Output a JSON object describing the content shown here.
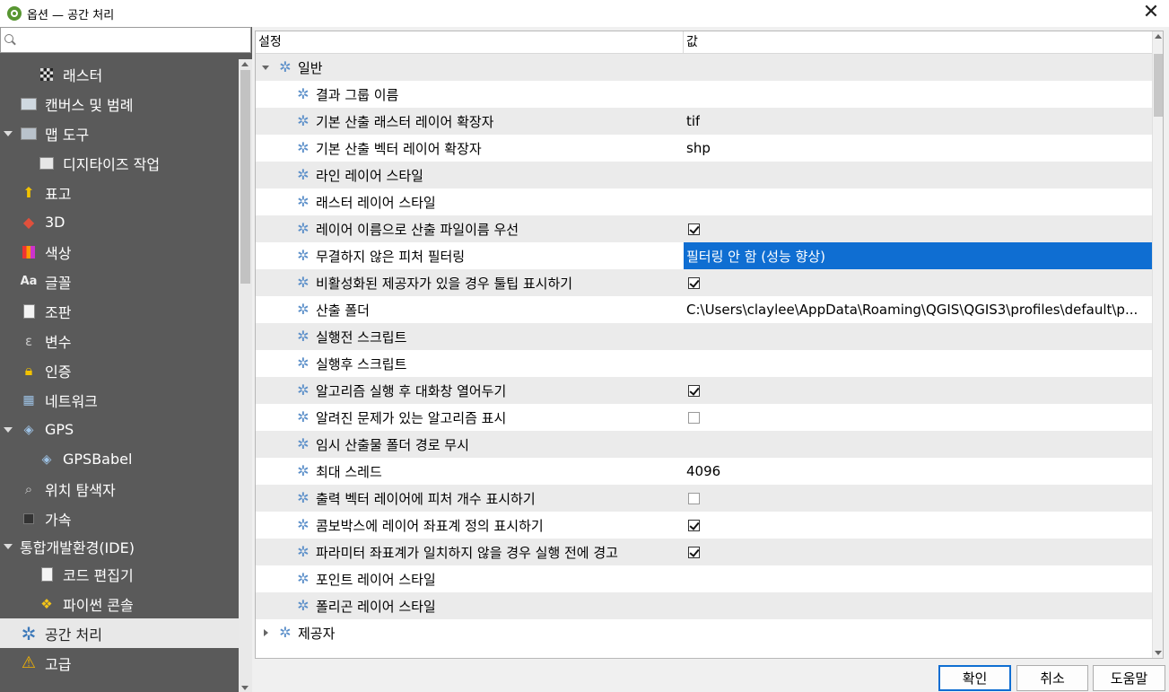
{
  "window": {
    "title": "옵션 — 공간 처리",
    "close_glyph": "✕"
  },
  "sidebar": {
    "search_placeholder": "",
    "items": [
      {
        "label": "래스터",
        "icon": "raster-checker-icon",
        "indent": 1,
        "expanded": null
      },
      {
        "label": "캔버스 및 범례",
        "icon": "canvas-legend-icon",
        "indent": 0,
        "expanded": null
      },
      {
        "label": "맵 도구",
        "icon": "map-tools-icon",
        "indent": 0,
        "expanded": true
      },
      {
        "label": "디지타이즈 작업",
        "icon": "digitize-icon",
        "indent": 1,
        "expanded": null
      },
      {
        "label": "표고",
        "icon": "elevation-icon",
        "indent": 0,
        "expanded": null
      },
      {
        "label": "3D",
        "icon": "cube-3d-icon",
        "indent": 0,
        "expanded": null
      },
      {
        "label": "색상",
        "icon": "color-grid-icon",
        "indent": 0,
        "expanded": null
      },
      {
        "label": "글꼴",
        "icon": "font-aa-icon",
        "indent": 0,
        "expanded": null
      },
      {
        "label": "조판",
        "icon": "layout-icon",
        "indent": 0,
        "expanded": null
      },
      {
        "label": "변수",
        "icon": "variable-icon",
        "indent": 0,
        "expanded": null
      },
      {
        "label": "인증",
        "icon": "lock-icon",
        "indent": 0,
        "expanded": null
      },
      {
        "label": "네트워크",
        "icon": "network-icon",
        "indent": 0,
        "expanded": null
      },
      {
        "label": "GPS",
        "icon": "gps-icon",
        "indent": 0,
        "expanded": true
      },
      {
        "label": "GPSBabel",
        "icon": "gpsbabel-icon",
        "indent": 1,
        "expanded": null
      },
      {
        "label": "위치 탐색자",
        "icon": "magnifier-icon",
        "indent": 0,
        "expanded": null
      },
      {
        "label": "가속",
        "icon": "chip-icon",
        "indent": 0,
        "expanded": null
      },
      {
        "label": "통합개발환경(IDE)",
        "icon": "",
        "indent": 0,
        "expanded": true
      },
      {
        "label": "코드 편집기",
        "icon": "code-editor-icon",
        "indent": 1,
        "expanded": null
      },
      {
        "label": "파이썬 콘솔",
        "icon": "python-icon",
        "indent": 1,
        "expanded": null
      },
      {
        "label": "공간 처리",
        "icon": "processing-gear-icon",
        "indent": 0,
        "expanded": null,
        "selected": true
      },
      {
        "label": "고급",
        "icon": "warning-icon",
        "indent": 0,
        "expanded": null
      }
    ]
  },
  "tree": {
    "columns": [
      "설정",
      "값"
    ],
    "rows": [
      {
        "name": "일반",
        "value": "",
        "level": 0,
        "expand": "down"
      },
      {
        "name": "결과 그룹 이름",
        "value": "",
        "level": 1
      },
      {
        "name": "기본 산출 래스터 레이어 확장자",
        "value": "tif",
        "level": 1
      },
      {
        "name": "기본 산출 벡터 레이어 확장자",
        "value": "shp",
        "level": 1
      },
      {
        "name": "라인 레이어 스타일",
        "value": "",
        "level": 1
      },
      {
        "name": "래스터 레이어 스타일",
        "value": "",
        "level": 1
      },
      {
        "name": "레이어 이름으로 산출 파일이름 우선",
        "value": "",
        "check": true,
        "level": 1
      },
      {
        "name": "무결하지 않은 피처 필터링",
        "value": "필터링 안 함 (성능 향상)",
        "level": 1,
        "selected": true
      },
      {
        "name": "비활성화된 제공자가 있을 경우 툴팁 표시하기",
        "value": "",
        "check": true,
        "level": 1
      },
      {
        "name": "산출 폴더",
        "value": "C:\\Users\\claylee\\AppData\\Roaming\\QGIS\\QGIS3\\profiles\\default\\p...",
        "level": 1
      },
      {
        "name": "실행전 스크립트",
        "value": "",
        "level": 1
      },
      {
        "name": "실행후 스크립트",
        "value": "",
        "level": 1
      },
      {
        "name": "알고리즘 실행 후 대화창 열어두기",
        "value": "",
        "check": true,
        "level": 1
      },
      {
        "name": "알려진 문제가 있는 알고리즘 표시",
        "value": "",
        "check": false,
        "level": 1
      },
      {
        "name": "임시 산출물 폴더 경로 무시",
        "value": "",
        "level": 1
      },
      {
        "name": "최대 스레드",
        "value": "4096",
        "level": 1
      },
      {
        "name": "출력 벡터 레이어에 피처 개수 표시하기",
        "value": "",
        "check": false,
        "level": 1
      },
      {
        "name": "콤보박스에 레이어 좌표계 정의 표시하기",
        "value": "",
        "check": true,
        "level": 1
      },
      {
        "name": "파라미터 좌표계가 일치하지 않을 경우 실행 전에 경고",
        "value": "",
        "check": true,
        "level": 1
      },
      {
        "name": "포인트 레이어 스타일",
        "value": "",
        "level": 1
      },
      {
        "name": "폴리곤 레이어 스타일",
        "value": "",
        "level": 1
      },
      {
        "name": "제공자",
        "value": "",
        "level": 0,
        "expand": "right"
      }
    ]
  },
  "buttons": {
    "ok": "확인",
    "cancel": "취소",
    "help": "도움말"
  },
  "colors": {
    "selection": "#0f6ed2",
    "sidebar_bg": "#5a5a5a",
    "gear": "#5b8fc9"
  }
}
